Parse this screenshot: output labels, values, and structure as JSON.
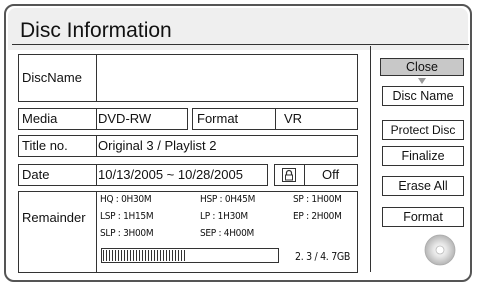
{
  "title": "Disc Information",
  "fields": {
    "disc_name_label": "DiscName",
    "disc_name_value": "",
    "media_label": "Media",
    "media_value": "DVD-RW",
    "format_label": "Format",
    "format_value": "VR",
    "title_no_label": "Title no.",
    "title_no_value": "Original 3  /  Playlist 2",
    "date_label": "Date",
    "date_value": "10/13/2005 ~ 10/28/2005",
    "protect_status": "Off",
    "remainder_label": "Remainder"
  },
  "remainder": {
    "modes": [
      "HQ : 0H30M",
      "HSP : 0H45M",
      "SP : 1H00M",
      "LSP : 1H15M",
      "LP : 1H30M",
      "EP : 2H00M",
      "SLP : 3H00M",
      "SEP : 4H00M"
    ],
    "capacity_text": "2. 3 / 4. 7GB",
    "used_fraction": 0.49
  },
  "buttons": {
    "close": "Close",
    "disc_name": "Disc Name",
    "protect_disc": "Protect Disc",
    "finalize": "Finalize",
    "erase_all": "Erase All",
    "format": "Format"
  },
  "icons": {
    "protect": "lock-icon",
    "disc": "disc-icon"
  }
}
